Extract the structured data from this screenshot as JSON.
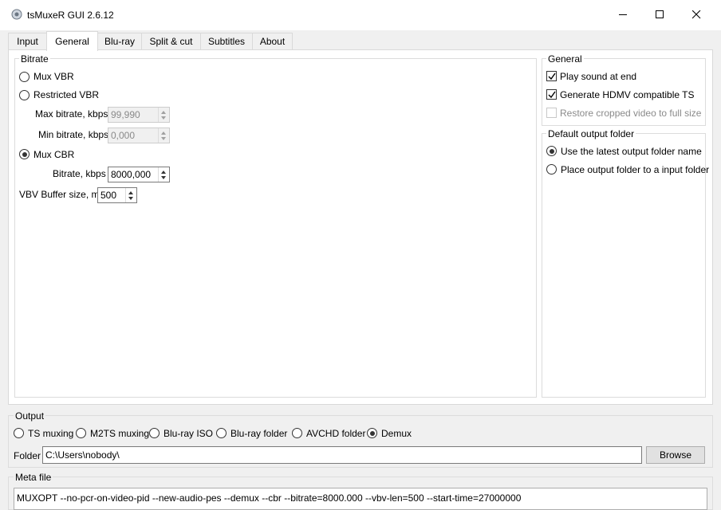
{
  "window": {
    "title": "tsMuxeR GUI 2.6.12",
    "buttons": [
      "minimize-icon",
      "maximize-icon",
      "close-icon"
    ]
  },
  "tabs": [
    {
      "label": "Input",
      "active": false
    },
    {
      "label": "General",
      "active": true
    },
    {
      "label": "Blu-ray",
      "active": false
    },
    {
      "label": "Split & cut",
      "active": false
    },
    {
      "label": "Subtitles",
      "active": false
    },
    {
      "label": "About",
      "active": false
    }
  ],
  "bitrate": {
    "title": "Bitrate",
    "mux_vbr": "Mux VBR",
    "restricted_vbr": "Restricted VBR",
    "max_bitrate_label": "Max bitrate, kbps",
    "max_bitrate_value": "99,990",
    "min_bitrate_label": "Min bitrate, kbps",
    "min_bitrate_value": "0,000",
    "mux_cbr": "Mux CBR",
    "bitrate_label": "Bitrate, kbps",
    "bitrate_value": "8000,000",
    "vbv_label": "VBV Buffer size, ms",
    "vbv_value": "500",
    "selected": "Mux CBR"
  },
  "general": {
    "title": "General",
    "play_sound": "Play sound at end",
    "play_sound_checked": true,
    "hdmv": "Generate HDMV compatible TS",
    "hdmv_checked": true,
    "restore_cropped": "Restore cropped video to full size",
    "restore_cropped_checked": false,
    "restore_cropped_enabled": false
  },
  "output_folder": {
    "title": "Default output folder",
    "latest": "Use the latest output folder name",
    "input_folder": "Place output folder to a input folder",
    "selected": "Use the latest output folder name"
  },
  "output": {
    "title": "Output",
    "options": [
      "TS muxing",
      "M2TS muxing",
      "Blu-ray ISO",
      "Blu-ray folder",
      "AVCHD folder",
      "Demux"
    ],
    "selected": "Demux",
    "folder_label": "Folder",
    "folder_value": "C:\\Users\\nobody\\",
    "browse": "Browse"
  },
  "meta": {
    "title": "Meta file",
    "line": "MUXOPT --no-pcr-on-video-pid --new-audio-pes --demux --cbr  --bitrate=8000.000 --vbv-len=500 --start-time=27000000"
  }
}
